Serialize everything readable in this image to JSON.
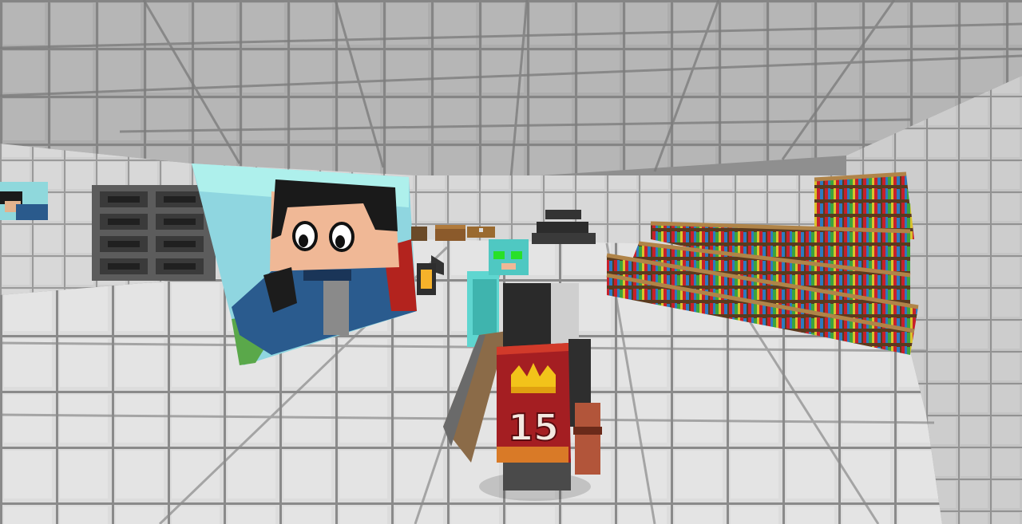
{
  "scene": {
    "kind": "minecraft-third-person-view",
    "room": "stone-tile-room",
    "colors": {
      "tile_light": "#d9d9d9",
      "tile_mid": "#c4c4c4",
      "grout": "#7a7a7a",
      "ceiling": "#b4b4b4",
      "wood": "#9a6b3a",
      "cape_red": "#a41e22",
      "crown_gold": "#f2c31a",
      "diamond": "#5fd6d0"
    }
  },
  "painting": {
    "subject": "cartoon-man-in-blue-jacket"
  },
  "player": {
    "cape_number": "15",
    "cape_emblem": "crown-icon",
    "items": [
      "shield",
      "sword"
    ]
  },
  "npc": {
    "armor": "diamond-armor",
    "helmet": "diamond-helmet"
  },
  "props": [
    "furnace-stack",
    "bookshelf-stairs",
    "anvil-stack",
    "lantern",
    "crafting-table",
    "chest"
  ]
}
